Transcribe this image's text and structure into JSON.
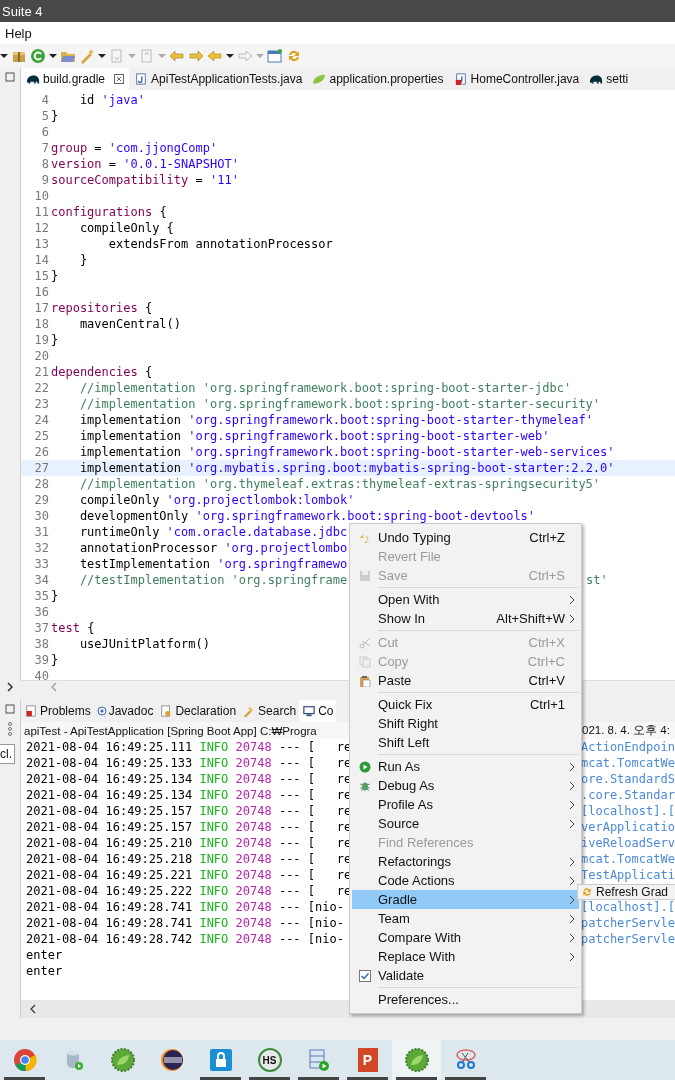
{
  "window": {
    "title": "Suite 4"
  },
  "menu_bar": [
    "Help"
  ],
  "editor_tabs": [
    {
      "label": "build.gradle",
      "selected": true,
      "closable": true,
      "kind": "gradle"
    },
    {
      "label": "ApiTestApplicationTests.java",
      "selected": false,
      "closable": false,
      "kind": "java"
    },
    {
      "label": "application.properties",
      "selected": false,
      "closable": false,
      "kind": "spring"
    },
    {
      "label": "HomeController.java",
      "selected": false,
      "closable": false,
      "kind": "java-error"
    },
    {
      "label": "setti",
      "selected": false,
      "closable": false,
      "kind": "gradle"
    }
  ],
  "code_lines": [
    {
      "n": "4",
      "current": false,
      "parts": [
        {
          "kind": "plain",
          "text": "    id "
        },
        {
          "kind": "str",
          "text": "'java'"
        }
      ]
    },
    {
      "n": "5",
      "current": false,
      "parts": [
        {
          "kind": "plain",
          "text": "}"
        }
      ]
    },
    {
      "n": "6",
      "current": false
    },
    {
      "n": "7",
      "current": false,
      "parts": [
        {
          "kind": "kw",
          "text": "group"
        },
        {
          "kind": "plain",
          "text": " = "
        },
        {
          "kind": "str",
          "text": "'com.jjongComp'"
        }
      ]
    },
    {
      "n": "8",
      "current": false,
      "parts": [
        {
          "kind": "kw",
          "text": "version"
        },
        {
          "kind": "plain",
          "text": " = "
        },
        {
          "kind": "str",
          "text": "'0.0.1-SNAPSHOT'"
        }
      ]
    },
    {
      "n": "9",
      "current": false,
      "parts": [
        {
          "kind": "kw",
          "text": "sourceCompatibility"
        },
        {
          "kind": "plain",
          "text": " = "
        },
        {
          "kind": "str",
          "text": "'11'"
        }
      ]
    },
    {
      "n": "10",
      "current": false
    },
    {
      "n": "11",
      "current": false,
      "parts": [
        {
          "kind": "kw",
          "text": "configurations"
        },
        {
          "kind": "plain",
          "text": " {"
        }
      ]
    },
    {
      "n": "12",
      "current": false,
      "parts": [
        {
          "kind": "plain",
          "text": "    compileOnly {"
        }
      ]
    },
    {
      "n": "13",
      "current": false,
      "parts": [
        {
          "kind": "plain",
          "text": "        extendsFrom annotationProcessor"
        }
      ]
    },
    {
      "n": "14",
      "current": false,
      "parts": [
        {
          "kind": "plain",
          "text": "    }"
        }
      ]
    },
    {
      "n": "15",
      "current": false,
      "parts": [
        {
          "kind": "plain",
          "text": "}"
        }
      ]
    },
    {
      "n": "16",
      "current": false
    },
    {
      "n": "17",
      "current": false,
      "parts": [
        {
          "kind": "kw",
          "text": "repositories"
        },
        {
          "kind": "plain",
          "text": " {"
        }
      ]
    },
    {
      "n": "18",
      "current": false,
      "parts": [
        {
          "kind": "plain",
          "text": "    mavenCentral()"
        }
      ]
    },
    {
      "n": "19",
      "current": false,
      "parts": [
        {
          "kind": "plain",
          "text": "}"
        }
      ]
    },
    {
      "n": "20",
      "current": false
    },
    {
      "n": "21",
      "current": false,
      "parts": [
        {
          "kind": "kw",
          "text": "dependencies"
        },
        {
          "kind": "plain",
          "text": " {"
        }
      ]
    },
    {
      "n": "22",
      "current": false,
      "parts": [
        {
          "kind": "comment",
          "text": "    //implementation 'org.springframework.boot:spring-boot-starter-jdbc'"
        }
      ]
    },
    {
      "n": "23",
      "current": false,
      "parts": [
        {
          "kind": "comment",
          "text": "    //implementation 'org.springframework.boot:spring-boot-starter-security'"
        }
      ]
    },
    {
      "n": "24",
      "current": false,
      "parts": [
        {
          "kind": "plain",
          "text": "    implementation "
        },
        {
          "kind": "str",
          "text": "'org.springframework.boot:spring-boot-starter-thymeleaf'"
        }
      ]
    },
    {
      "n": "25",
      "current": false,
      "parts": [
        {
          "kind": "plain",
          "text": "    implementation "
        },
        {
          "kind": "str",
          "text": "'org.springframework.boot:spring-boot-starter-web'"
        }
      ]
    },
    {
      "n": "26",
      "current": false,
      "parts": [
        {
          "kind": "plain",
          "text": "    implementation "
        },
        {
          "kind": "str",
          "text": "'org.springframework.boot:spring-boot-starter-web-services'"
        }
      ]
    },
    {
      "n": "27",
      "current": true,
      "parts": [
        {
          "kind": "plain",
          "text": "    implementation "
        },
        {
          "kind": "str",
          "text": "'org.mybatis.spring.boot:mybatis-spring-boot-starter:2.2.0'"
        }
      ]
    },
    {
      "n": "28",
      "current": false,
      "parts": [
        {
          "kind": "comment",
          "text": "    //implementation 'org.thymeleaf.extras:thymeleaf-extras-springsecurity5'"
        }
      ]
    },
    {
      "n": "29",
      "current": false,
      "parts": [
        {
          "kind": "plain",
          "text": "    compileOnly "
        },
        {
          "kind": "str",
          "text": "'org.projectlombok:lombok'"
        }
      ]
    },
    {
      "n": "30",
      "current": false,
      "parts": [
        {
          "kind": "plain",
          "text": "    developmentOnly "
        },
        {
          "kind": "str",
          "text": "'org.springframework.boot:spring-boot-devtools'"
        }
      ]
    },
    {
      "n": "31",
      "current": false,
      "parts": [
        {
          "kind": "plain",
          "text": "    runtimeOnly "
        },
        {
          "kind": "str",
          "text": "'com.oracle.database.jdbc"
        }
      ]
    },
    {
      "n": "32",
      "current": false,
      "parts": [
        {
          "kind": "plain",
          "text": "    annotationProcessor "
        },
        {
          "kind": "str",
          "text": "'org.projectlombo"
        }
      ]
    },
    {
      "n": "33",
      "current": false,
      "parts": [
        {
          "kind": "plain",
          "text": "    testImplementation "
        },
        {
          "kind": "str",
          "text": "'org.springframewo"
        }
      ]
    },
    {
      "n": "34",
      "current": false,
      "parts": [
        {
          "kind": "comment",
          "text": "    //testImplementation 'org.springframe"
        }
      ],
      "tail": {
        "kind": "comment",
        "text": "st'"
      }
    },
    {
      "n": "35",
      "current": false,
      "parts": [
        {
          "kind": "plain",
          "text": "}"
        }
      ]
    },
    {
      "n": "36",
      "current": false
    },
    {
      "n": "37",
      "current": false,
      "parts": [
        {
          "kind": "kw",
          "text": "test"
        },
        {
          "kind": "plain",
          "text": " {"
        }
      ]
    },
    {
      "n": "38",
      "current": false,
      "parts": [
        {
          "kind": "plain",
          "text": "    useJUnitPlatform()"
        }
      ]
    },
    {
      "n": "39",
      "current": false,
      "parts": [
        {
          "kind": "plain",
          "text": "}"
        }
      ]
    },
    {
      "n": "40",
      "current": false
    }
  ],
  "panel_tabs": [
    {
      "label": "Problems",
      "selected": false
    },
    {
      "label": "Javadoc",
      "selected": false
    },
    {
      "label": "Declaration",
      "selected": false
    },
    {
      "label": "Search",
      "selected": false
    },
    {
      "label": "Co",
      "selected": true
    }
  ],
  "console": {
    "title": "apiTest - ApiTestApplication [Spring Boot App] C:₩Progra",
    "title_tail": "021. 8. 4. 오후 4:",
    "filter_field": "cl.",
    "rows": [
      {
        "kind": "log",
        "time": "2021-08-04 16:49:25.111",
        "level": "INFO",
        "pid": "20748",
        "dashes": "---",
        "thread": "[   re",
        "tail": "ActionEndpoin"
      },
      {
        "kind": "log",
        "time": "2021-08-04 16:49:25.133",
        "level": "INFO",
        "pid": "20748",
        "dashes": "---",
        "thread": "[   re",
        "tail": "mcat.TomcatWe"
      },
      {
        "kind": "log",
        "time": "2021-08-04 16:49:25.134",
        "level": "INFO",
        "pid": "20748",
        "dashes": "---",
        "thread": "[   re",
        "tail": "ore.StandardS"
      },
      {
        "kind": "log",
        "time": "2021-08-04 16:49:25.134",
        "level": "INFO",
        "pid": "20748",
        "dashes": "---",
        "thread": "[   re",
        "tail": ".core.Standar"
      },
      {
        "kind": "log",
        "time": "2021-08-04 16:49:25.157",
        "level": "INFO",
        "pid": "20748",
        "dashes": "---",
        "thread": "[   re",
        "tail": "[localhost].["
      },
      {
        "kind": "log",
        "time": "2021-08-04 16:49:25.157",
        "level": "INFO",
        "pid": "20748",
        "dashes": "---",
        "thread": "[   re",
        "tail": "verApplicatio"
      },
      {
        "kind": "log",
        "time": "2021-08-04 16:49:25.210",
        "level": "INFO",
        "pid": "20748",
        "dashes": "---",
        "thread": "[   re",
        "tail": "iveReloadServ"
      },
      {
        "kind": "log",
        "time": "2021-08-04 16:49:25.218",
        "level": "INFO",
        "pid": "20748",
        "dashes": "---",
        "thread": "[   re",
        "tail": "mcat.TomcatWe"
      },
      {
        "kind": "log",
        "time": "2021-08-04 16:49:25.221",
        "level": "INFO",
        "pid": "20748",
        "dashes": "---",
        "thread": "[   re",
        "tail": "TestApplicati"
      },
      {
        "kind": "log",
        "time": "2021-08-04 16:49:25.222",
        "level": "INFO",
        "pid": "20748",
        "dashes": "---",
        "thread": "[   re"
      },
      {
        "kind": "log",
        "time": "2021-08-04 16:49:28.741",
        "level": "INFO",
        "pid": "20748",
        "dashes": "---",
        "thread": "[nio-",
        "tail": "[localhost].["
      },
      {
        "kind": "log",
        "time": "2021-08-04 16:49:28.741",
        "level": "INFO",
        "pid": "20748",
        "dashes": "---",
        "thread": "[nio-",
        "tail": "patcherServle"
      },
      {
        "kind": "log",
        "time": "2021-08-04 16:49:28.742",
        "level": "INFO",
        "pid": "20748",
        "dashes": "---",
        "thread": "[nio-",
        "tail": "patcherServle"
      },
      {
        "kind": "text",
        "text": "enter"
      },
      {
        "kind": "text",
        "text": "enter"
      }
    ]
  },
  "context_menu": [
    {
      "kind": "item",
      "label": "Undo Typing",
      "shortcut": "Ctrl+Z",
      "disabled": false,
      "submenu": false,
      "selected": false
    },
    {
      "kind": "item",
      "label": "Revert File",
      "disabled": true,
      "submenu": false,
      "selected": false
    },
    {
      "kind": "item",
      "label": "Save",
      "shortcut": "Ctrl+S",
      "disabled": true,
      "submenu": false,
      "selected": false
    },
    {
      "kind": "separator"
    },
    {
      "kind": "item",
      "label": "Open With",
      "disabled": false,
      "submenu": true,
      "selected": false
    },
    {
      "kind": "item",
      "label": "Show In",
      "shortcut": "Alt+Shift+W",
      "disabled": false,
      "submenu": true,
      "selected": false
    },
    {
      "kind": "separator"
    },
    {
      "kind": "item",
      "label": "Cut",
      "shortcut": "Ctrl+X",
      "disabled": true,
      "submenu": false,
      "selected": false
    },
    {
      "kind": "item",
      "label": "Copy",
      "shortcut": "Ctrl+C",
      "disabled": true,
      "submenu": false,
      "selected": false
    },
    {
      "kind": "item",
      "label": "Paste",
      "shortcut": "Ctrl+V",
      "disabled": false,
      "submenu": false,
      "selected": false
    },
    {
      "kind": "separator"
    },
    {
      "kind": "item",
      "label": "Quick Fix",
      "shortcut": "Ctrl+1",
      "disabled": false,
      "submenu": false,
      "selected": false
    },
    {
      "kind": "item",
      "label": "Shift Right",
      "disabled": false,
      "submenu": false,
      "selected": false
    },
    {
      "kind": "item",
      "label": "Shift Left",
      "disabled": false,
      "submenu": false,
      "selected": false
    },
    {
      "kind": "separator"
    },
    {
      "kind": "item",
      "label": "Run As",
      "disabled": false,
      "submenu": true,
      "selected": false
    },
    {
      "kind": "item",
      "label": "Debug As",
      "disabled": false,
      "submenu": true,
      "selected": false
    },
    {
      "kind": "item",
      "label": "Profile As",
      "disabled": false,
      "submenu": true,
      "selected": false
    },
    {
      "kind": "item",
      "label": "Source",
      "disabled": false,
      "submenu": true,
      "selected": false
    },
    {
      "kind": "item",
      "label": "Find References",
      "disabled": true,
      "submenu": false,
      "selected": false
    },
    {
      "kind": "item",
      "label": "Refactorings",
      "disabled": false,
      "submenu": true,
      "selected": false
    },
    {
      "kind": "item",
      "label": "Code Actions",
      "disabled": false,
      "submenu": true,
      "selected": false
    },
    {
      "kind": "item",
      "label": "Gradle",
      "disabled": false,
      "submenu": true,
      "selected": true
    },
    {
      "kind": "item",
      "label": "Team",
      "disabled": false,
      "submenu": true,
      "selected": false
    },
    {
      "kind": "item",
      "label": "Compare With",
      "disabled": false,
      "submenu": true,
      "selected": false
    },
    {
      "kind": "item",
      "label": "Replace With",
      "disabled": false,
      "submenu": true,
      "selected": false
    },
    {
      "kind": "check",
      "label": "Validate",
      "checked": true,
      "disabled": false,
      "submenu": false,
      "selected": false
    },
    {
      "kind": "separator"
    },
    {
      "kind": "item",
      "label": "Preferences...",
      "disabled": false,
      "submenu": false,
      "selected": false
    }
  ],
  "submenu": [
    {
      "label": "Refresh Grad"
    }
  ],
  "taskbar": [
    {
      "kind": "browser",
      "running": true,
      "selected": false
    },
    {
      "kind": "database",
      "running": false,
      "selected": false
    },
    {
      "kind": "leaf",
      "running": false,
      "selected": false
    },
    {
      "kind": "eclipse",
      "running": false,
      "selected": false
    },
    {
      "kind": "lock",
      "running": true,
      "selected": false
    },
    {
      "kind": "badge",
      "text": "HS",
      "running": true,
      "selected": false
    },
    {
      "kind": "sheet",
      "running": true,
      "selected": false
    },
    {
      "kind": "slides",
      "text": "P",
      "running": true,
      "selected": false
    },
    {
      "kind": "leaf",
      "running": true,
      "selected": true
    },
    {
      "kind": "scissors",
      "running": true,
      "selected": false
    }
  ]
}
